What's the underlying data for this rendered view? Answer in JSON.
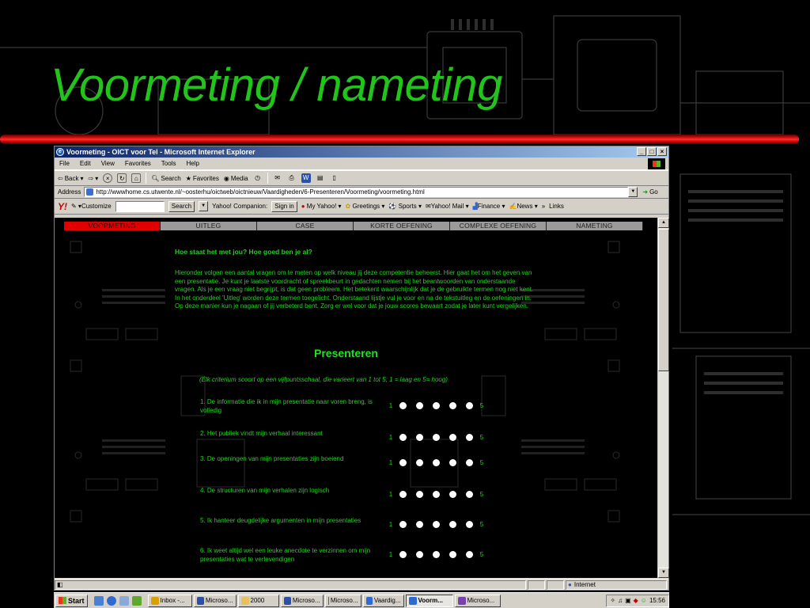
{
  "slide": {
    "title": "Voormeting / nameting"
  },
  "window": {
    "title": "Voormeting - OICT voor Tel - Microsoft Internet Explorer",
    "controls": {
      "minimize": "_",
      "maximize": "□",
      "close": "×"
    }
  },
  "menu": [
    "File",
    "Edit",
    "View",
    "Favorites",
    "Tools",
    "Help"
  ],
  "toolbar": {
    "back": "Back",
    "search": "Search",
    "favorites": "Favorites",
    "media": "Media"
  },
  "address": {
    "label": "Address",
    "url": "http://wwwhome.cs.utwente.nl/~oosterhu/oictweb/oictnieuw/Vaardigheden/6-Presenteren/Voormeting/voormeting.html",
    "go": "Go"
  },
  "yahoo": {
    "customize": "Customize",
    "search": "Search",
    "companion": "Yahoo! Companion:",
    "signin": "Sign in",
    "my_yahoo": "My Yahoo!",
    "greetings": "Greetings",
    "sports": "Sports",
    "mail": "Yahoo! Mail",
    "finance": "Finance",
    "news": "News",
    "more": "»",
    "links": "Links"
  },
  "page": {
    "tabs": [
      "VOORMETING",
      "UITLEG",
      "CASE",
      "KORTE OEFENING",
      "COMPLEXE OEFENING",
      "NAMETING"
    ],
    "active_tab": "VOORMETING",
    "heading": "Hoe staat het met jou? Hoe goed ben je al?",
    "intro": "Hieronder volgen een aantal vragen om te meten op welk niveau jij deze competentie beheerst. Hier gaat het om het geven van een presentatie. Je kunt je laatste voordracht of spreekbeurt in gedachten nemen bij het beantwoorden van onderstaande vragen. Als je een vraag niet begrijpt, is dat geen probleem. Het betekent waarschijnlijk dat je de gebruikte termen nog niet kent. In het onderdeel 'Uitleg' worden deze termen toegelicht. Onderstaand lijstje vul je voor en na de tekstuitleg en de oefeningen in. Op deze manier kun je nagaan of jij verbeterd bent. Zorg er wel voor dat je jouw scores bewaart zodat je later kunt vergelijken.",
    "section_title": "Presenteren",
    "scale_note": "(Elk criterium scoort op een vijfpuntsschaal, die varieert van 1 tot 5; 1 = laag en 5= hoog)",
    "scale_min": "1",
    "scale_max": "5",
    "questions": [
      "1. De informatie die ik in mijn presentatie naar voren breng, is volledig",
      "2. Het publiek vindt mijn verhaal interessant",
      "3. De openingen van mijn presentaties zijn boeiend",
      "4. De structuren van mijn verhalen zijn logisch",
      "5. Ik hanteer deugdelijke argumenten in mijn presentaties",
      "6. Ik weet altijd wel een leuke anecdote te verzinnen om mijn presentaties wat te verlevendigen"
    ]
  },
  "status": {
    "zone": "Internet"
  },
  "taskbar": {
    "start": "Start",
    "buttons": [
      "Inbox -...",
      "Microso...",
      "2000",
      "Microso...",
      "Microso...",
      "Vaardig...",
      "Voorm...",
      "Microso..."
    ],
    "active_index": 6,
    "clock": "15:56"
  },
  "colors": {
    "title_green": "#22c41c",
    "page_green": "#23d122",
    "active_tab": "#e00000",
    "tab_gray": "#9a9a9a"
  }
}
